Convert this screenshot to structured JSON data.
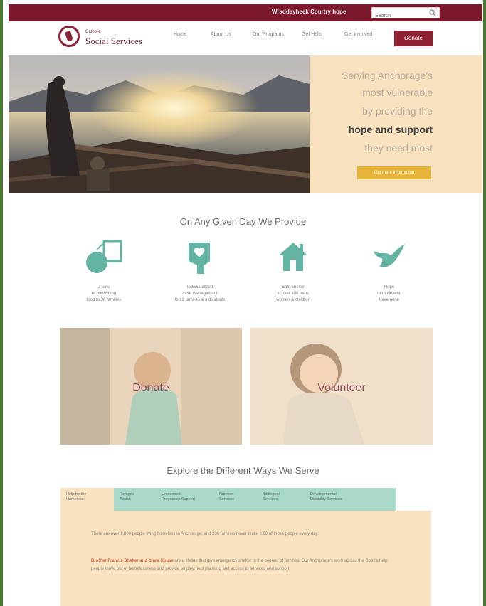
{
  "topbar": {
    "title": "Wraddayheek Courtry hope",
    "search_placeholder": "Search"
  },
  "logo": {
    "small": "Catholic",
    "big": "Social Services"
  },
  "nav": [
    {
      "label": "Home"
    },
    {
      "label": "About Us"
    },
    {
      "label": "Our Programs"
    },
    {
      "label": "Get Help"
    },
    {
      "label": "Get Involved"
    }
  ],
  "donate_button": "Donate",
  "hero": {
    "lines": [
      "Serving Anchorage's",
      "most vulnerable",
      "by providing the",
      "hope and support",
      "they need most"
    ],
    "cta": "Get more information"
  },
  "section1_title": "On Any Given Day We Provide",
  "features": [
    {
      "icon": "apple-book-icon",
      "text": [
        "2 tons",
        "of nourishing",
        "food to 36 families"
      ]
    },
    {
      "icon": "heart-hand-icon",
      "text": [
        "Individualized",
        "case management",
        "to 12 families & individuals"
      ]
    },
    {
      "icon": "house-icon",
      "text": [
        "Safe shelter",
        "to over 100 men,",
        "women & children"
      ]
    },
    {
      "icon": "dove-icon",
      "text": [
        "Hope",
        "to those who",
        "have none"
      ]
    }
  ],
  "cards": [
    {
      "label": "Donate"
    },
    {
      "label": "Volunteer"
    }
  ],
  "section2_title": "Explore the Different Ways We Serve",
  "tabs": [
    {
      "label": [
        "Help for the",
        "Homeless"
      ]
    },
    {
      "label": [
        "Refugee",
        "Assist."
      ]
    },
    {
      "label": [
        "Unplanned",
        "Pregnancy Support"
      ]
    },
    {
      "label": [
        "Nutrition",
        "Services"
      ]
    },
    {
      "label": [
        "Biblingual",
        "Services"
      ]
    },
    {
      "label": [
        "Developmental",
        "Disability Services"
      ]
    }
  ],
  "tab_panel": {
    "paragraph1": "There are over 1,800 people living homeless in Anchorage, and 236 families never make it 60 of those people every day.",
    "paragraph2_emphasis": "Brother Francis Shelter and Clare House",
    "paragraph2": " are a lifeline that give emergency shelter to the poorest of families. Our Anchorage's work across the Cook's help people move out of homelessness and provide employment planning and access to services and support."
  },
  "colors": {
    "topbar": "#7b1a2c",
    "donate": "#8f1f32",
    "accent_teal": "#63b4a3",
    "cream": "#f8e2c0",
    "tab_teal": "#a8d9cb",
    "cta": "#e6b43b"
  }
}
